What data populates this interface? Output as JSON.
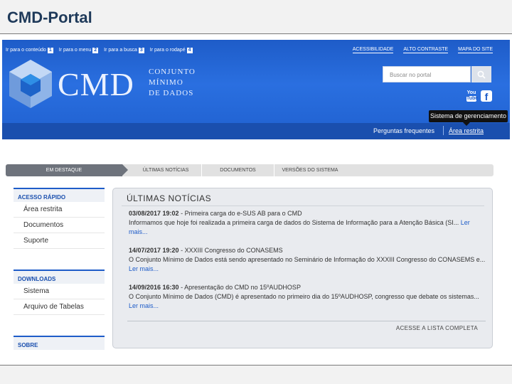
{
  "slide": {
    "title": "CMD-Portal"
  },
  "header": {
    "skip_links": [
      {
        "label": "Ir para o conteúdo",
        "key": "1"
      },
      {
        "label": "Ir para o menu",
        "key": "2"
      },
      {
        "label": "Ir para a busca",
        "key": "3"
      },
      {
        "label": "Ir para o rodapé",
        "key": "4"
      }
    ],
    "top_links": [
      "ACESSIBILIDADE",
      "ALTO CONTRASTE",
      "MAPA DO SITE"
    ],
    "logo": {
      "text": "CMD",
      "sub1": "CONJUNTO",
      "sub2": "MÍNIMO",
      "sub3": "DE DADOS"
    },
    "search_placeholder": "Buscar no portal",
    "social": {
      "youtube_1": "You",
      "youtube_2": "Tube",
      "facebook": "f"
    },
    "tooltip": "Sistema de gerenciamento",
    "faq_link": "Perguntas frequentes",
    "restricted_link": "Área restrita",
    "colors": {
      "brand_blue": "#1e5cc8",
      "dark_blue": "#1a4fae"
    }
  },
  "tabs": [
    {
      "label": "EM DESTAQUE",
      "active": true
    },
    {
      "label": "ÚLTIMAS NOTÍCIAS",
      "active": false
    },
    {
      "label": "DOCUMENTOS",
      "active": false
    },
    {
      "label": "VERSÕES DO SISTEMA",
      "active": false
    }
  ],
  "sidebar": {
    "quick_access": {
      "title": "ACESSO RÁPIDO",
      "items": [
        "Área restrita",
        "Documentos",
        "Suporte"
      ]
    },
    "downloads": {
      "title": "DOWNLOADS",
      "items": [
        "Sistema",
        "Arquivo de Tabelas"
      ]
    },
    "about": {
      "title": "SOBRE"
    }
  },
  "news": {
    "title": "ÚLTIMAS NOTÍCIAS",
    "items": [
      {
        "date": "03/08/2017 19:02",
        "headline": " - Primeira carga do e-SUS AB para o CMD",
        "body": "Informamos que hoje foi realizada a primeira carga de dados do Sistema de Informação para a Atenção Básica (SI...",
        "more": "Ler mais..."
      },
      {
        "date": "14/07/2017 19:20",
        "headline": " - XXXIII Congresso do CONASEMS",
        "body": "O Conjunto Mínimo de Dados está sendo apresentado no Seminário de Informação do XXXIII Congresso do CONASEMS e...",
        "more": "Ler mais..."
      },
      {
        "date": "14/09/2016 16:30",
        "headline": " - Apresentação do CMD no 15ºAUDHOSP",
        "body": "O Conjunto Mínimo de Dados (CMD) é apresentado no primeiro dia do 15ºAUDHOSP, congresso que debate os sistemas...",
        "more": "Ler mais..."
      }
    ],
    "all_link": "ACESSE A LISTA COMPLETA"
  }
}
